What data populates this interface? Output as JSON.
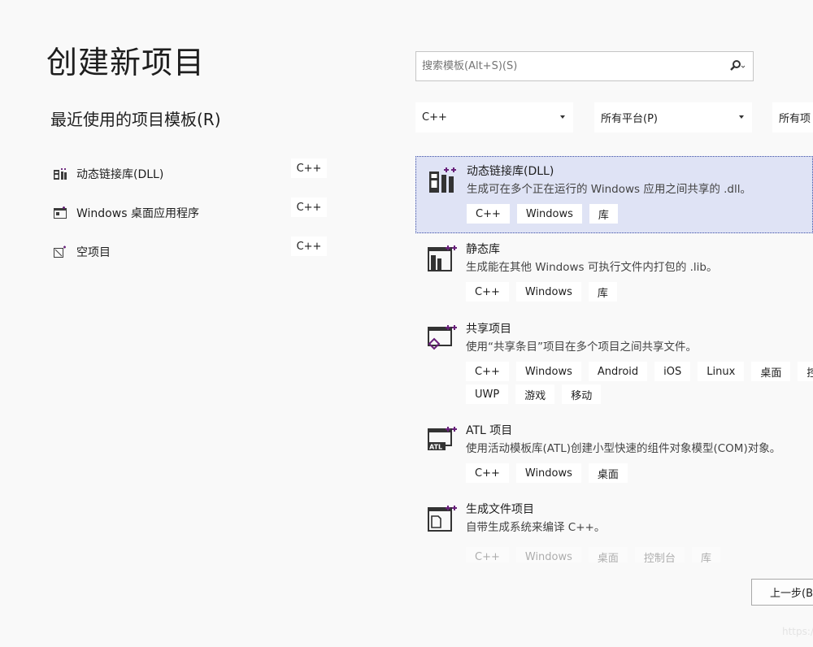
{
  "page_title": "创建新项目",
  "recent": {
    "title": "最近使用的项目模板(R)",
    "items": [
      {
        "icon": "dll-library-icon",
        "name": "动态链接库(DLL)",
        "lang": "C++"
      },
      {
        "icon": "windows-desktop-app-icon",
        "name": "Windows 桌面应用程序",
        "lang": "C++"
      },
      {
        "icon": "empty-project-icon",
        "name": "空项目",
        "lang": "C++"
      }
    ]
  },
  "search": {
    "placeholder": "搜索模板(Alt+S)(S)",
    "icon": "search-icon"
  },
  "filters": {
    "language": "C++",
    "platform": "所有平台(P)",
    "project_type": "所有项"
  },
  "templates": [
    {
      "icon": "dll-library-icon",
      "name": "动态链接库(DLL)",
      "desc": "生成可在多个正在运行的 Windows 应用之间共享的 .dll。",
      "tags": [
        "C++",
        "Windows",
        "库"
      ],
      "selected": true
    },
    {
      "icon": "static-library-icon",
      "name": "静态库",
      "desc": "生成能在其他 Windows 可执行文件内打包的 .lib。",
      "tags": [
        "C++",
        "Windows",
        "库"
      ]
    },
    {
      "icon": "shared-project-icon",
      "name": "共享项目",
      "desc": "使用“共享条目”项目在多个项目之间共享文件。",
      "tags": [
        "C++",
        "Windows",
        "Android",
        "iOS",
        "Linux",
        "桌面",
        "控制",
        "UWP",
        "游戏",
        "移动"
      ]
    },
    {
      "icon": "atl-project-icon",
      "name": "ATL 项目",
      "desc": "使用活动模板库(ATL)创建小型快速的组件对象模型(COM)对象。",
      "tags": [
        "C++",
        "Windows",
        "桌面"
      ]
    },
    {
      "icon": "makefile-project-icon",
      "name": "生成文件项目",
      "desc": "自带生成系统来编译 C++。",
      "tags": [
        "C++",
        "Windows",
        "桌面",
        "控制台",
        "库"
      ]
    }
  ],
  "buttons": {
    "prev": "上一步(B"
  },
  "watermark": "https:/",
  "colors": {
    "accent": "#68217a",
    "selected_bg": "#dfe3f5",
    "selected_border": "#3a4da5"
  }
}
